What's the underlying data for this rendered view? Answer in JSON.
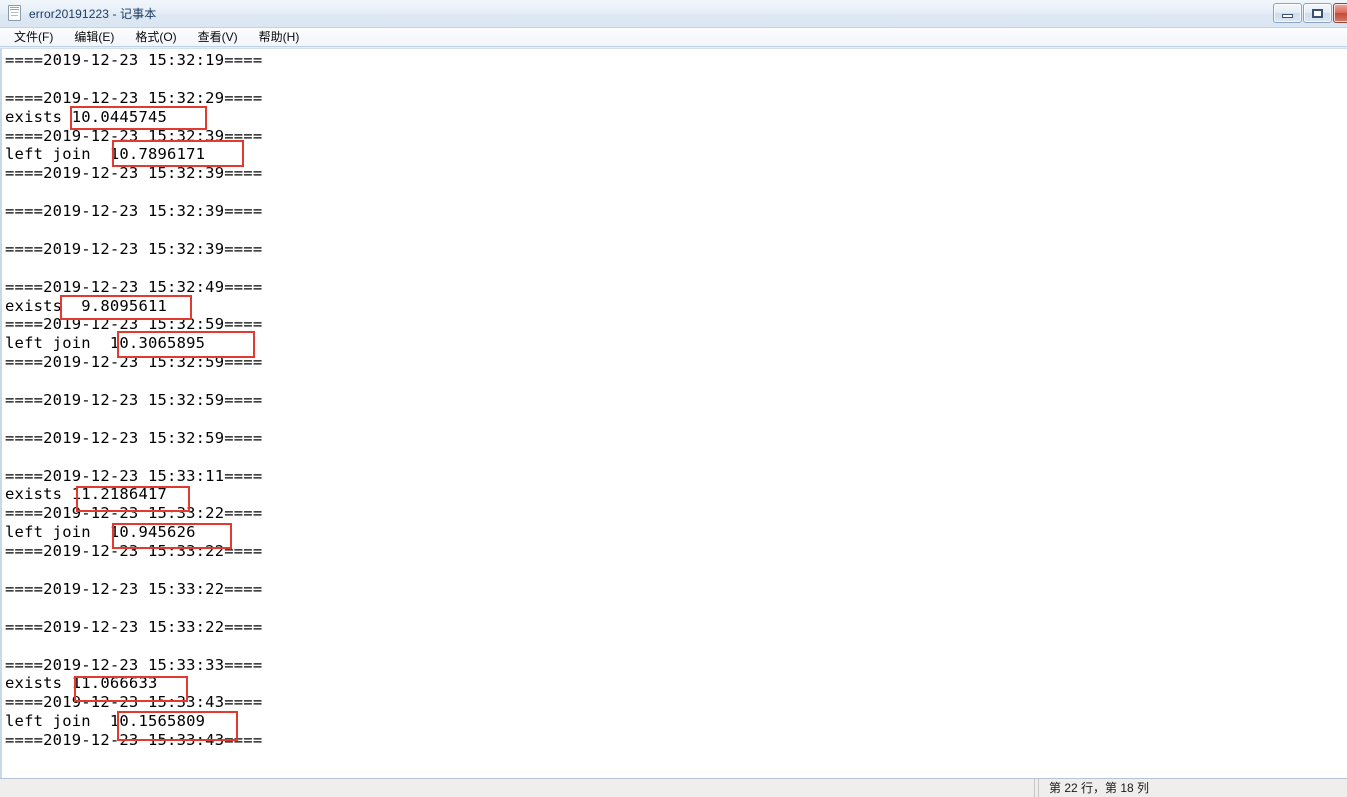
{
  "window": {
    "title": "error20191223 - 记事本",
    "icon": "notepad-icon",
    "buttons": {
      "minimize": "最小化",
      "maximize": "最大化",
      "close": "关闭"
    }
  },
  "menu": {
    "items": [
      {
        "label": "文件(F)",
        "name": "menu-file"
      },
      {
        "label": "编辑(E)",
        "name": "menu-edit"
      },
      {
        "label": "格式(O)",
        "name": "menu-format"
      },
      {
        "label": "查看(V)",
        "name": "menu-view"
      },
      {
        "label": "帮助(H)",
        "name": "menu-help"
      }
    ]
  },
  "editor": {
    "lines": [
      "====2019-12-23 15:32:19====",
      "",
      "====2019-12-23 15:32:29====",
      "exists 10.0445745",
      "====2019-12-23 15:32:39====",
      "left join  10.7896171",
      "====2019-12-23 15:32:39====",
      "",
      "====2019-12-23 15:32:39====",
      "",
      "====2019-12-23 15:32:39====",
      "",
      "====2019-12-23 15:32:49====",
      "exists  9.8095611",
      "====2019-12-23 15:32:59====",
      "left join  10.3065895",
      "====2019-12-23 15:32:59====",
      "",
      "====2019-12-23 15:32:59====",
      "",
      "====2019-12-23 15:32:59====",
      "",
      "====2019-12-23 15:33:11====",
      "exists 11.2186417",
      "====2019-12-23 15:33:22====",
      "left join  10.945626",
      "====2019-12-23 15:33:22====",
      "",
      "====2019-12-23 15:33:22====",
      "",
      "====2019-12-23 15:33:22====",
      "",
      "====2019-12-23 15:33:33====",
      "exists 11.066633",
      "====2019-12-23 15:33:43====",
      "left join  10.1565809",
      "====2019-12-23 15:33:43===="
    ],
    "highlighted_values": [
      {
        "label": "exists",
        "value": "10.0445745",
        "timestamp": "2019-12-23 15:32:29"
      },
      {
        "label": "left join",
        "value": "10.7896171",
        "timestamp": "2019-12-23 15:32:39"
      },
      {
        "label": "exists",
        "value": "9.8095611",
        "timestamp": "2019-12-23 15:32:49"
      },
      {
        "label": "left join",
        "value": "10.3065895",
        "timestamp": "2019-12-23 15:32:59"
      },
      {
        "label": "exists",
        "value": "11.2186417",
        "timestamp": "2019-12-23 15:33:11"
      },
      {
        "label": "left join",
        "value": "10.945626",
        "timestamp": "2019-12-23 15:33:22"
      },
      {
        "label": "exists",
        "value": "11.066633",
        "timestamp": "2019-12-23 15:33:33"
      },
      {
        "label": "left join",
        "value": "10.1565809",
        "timestamp": "2019-12-23 15:33:43"
      }
    ],
    "annotation_color": "#e23a2e"
  },
  "statusbar": {
    "position": "第 22 行，第 18 列"
  }
}
